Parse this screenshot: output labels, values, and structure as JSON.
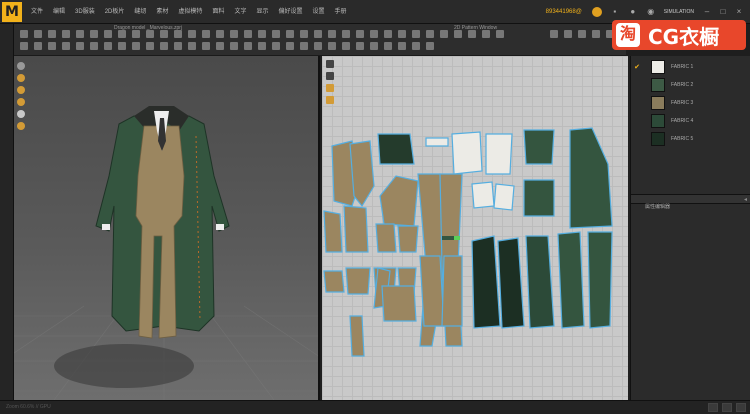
{
  "app": {
    "logo_letter": "M"
  },
  "menu": {
    "items": [
      "文件",
      "编辑",
      "3D服装",
      "2D板片",
      "缝纫",
      "素材",
      "虚拟模特",
      "面料",
      "文字",
      "显示",
      "偏好设置",
      "设置",
      "手册"
    ]
  },
  "top_right": {
    "user_id": "893441968@",
    "mode_label": "SIMULATION"
  },
  "watermark": {
    "text": "CG衣橱",
    "icon_glyph": "淘"
  },
  "viewport3d": {
    "title": "Dragon model _Marvelous.zprj"
  },
  "viewport2d": {
    "title": "2D Pattern Window"
  },
  "fabrics": [
    {
      "label": "FABRIC 1",
      "color": "#ecebe6",
      "selected": true
    },
    {
      "label": "FABRIC 2",
      "color": "#3d5a45",
      "selected": false
    },
    {
      "label": "FABRIC 3",
      "color": "#8a7c5c",
      "selected": false
    },
    {
      "label": "FABRIC 4",
      "color": "#2c4a38",
      "selected": false
    },
    {
      "label": "FABRIC 5",
      "color": "#1c2f23",
      "selected": false
    }
  ],
  "property_panel": {
    "title": "属性编辑器"
  },
  "statusbar": {
    "text": "Zoom 60.6% // GPU"
  },
  "colors": {
    "accent": "#f2b21b",
    "coat_green": "#34553f",
    "suit_tan": "#9b8660",
    "pattern_outline": "#55aee0"
  }
}
